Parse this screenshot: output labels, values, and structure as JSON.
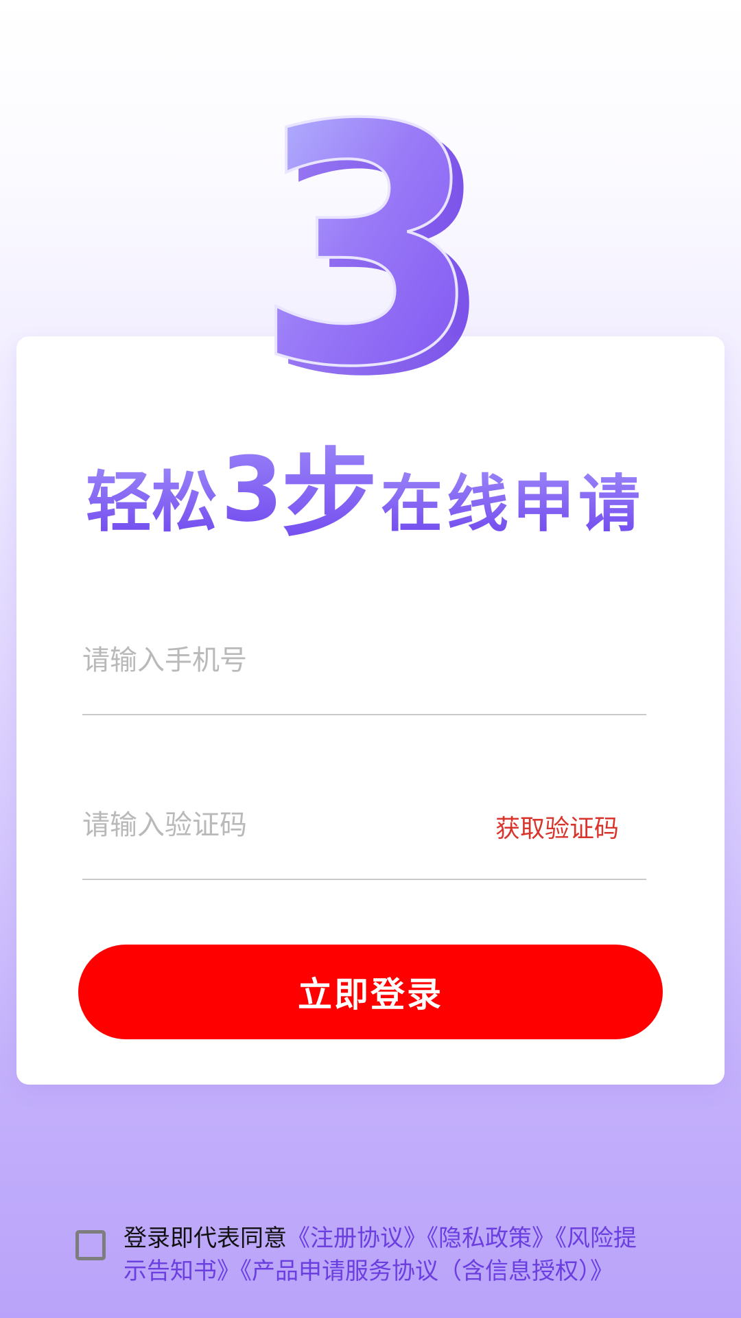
{
  "hero": {
    "big_number": "3",
    "slogan_part1": "轻松",
    "slogan_num": "3",
    "slogan_step": "步",
    "slogan_part2": "在线申请"
  },
  "form": {
    "phone_placeholder": "请输入手机号",
    "code_placeholder": "请输入验证码",
    "get_code_label": "获取验证码",
    "login_button": "立即登录"
  },
  "agreement": {
    "prefix": "登录即代表同意",
    "links": [
      "《注册协议》",
      "《隐私政策》",
      "《风险提示告知书》",
      "《产品申请服务协议（含信息授权）》"
    ],
    "checked": false
  },
  "colors": {
    "accent_purple": "#7a4cf0",
    "button_red": "#fe0000",
    "get_code_red": "#d9342b",
    "link_purple": "#6b3ee0"
  }
}
